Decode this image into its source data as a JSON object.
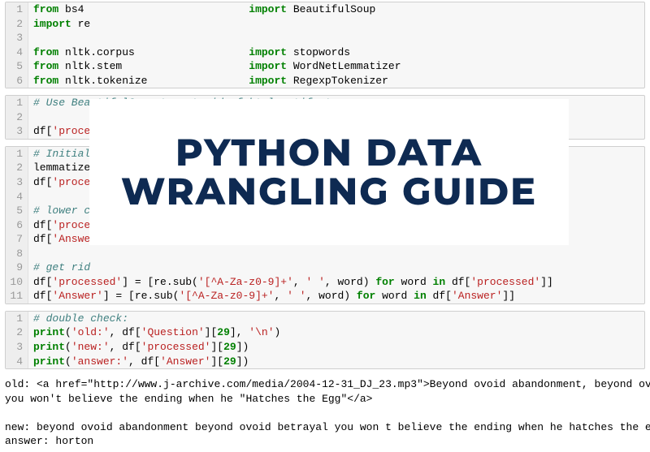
{
  "cells": [
    {
      "lines": [
        {
          "n": "1",
          "seg": [
            {
              "t": "from",
              "c": "kw"
            },
            {
              "t": " bs4                          ",
              "c": "nm"
            },
            {
              "t": "import",
              "c": "kw"
            },
            {
              "t": " BeautifulSoup",
              "c": "nm"
            }
          ]
        },
        {
          "n": "2",
          "seg": [
            {
              "t": "import",
              "c": "kw"
            },
            {
              "t": " re",
              "c": "nm"
            }
          ]
        },
        {
          "n": "3",
          "seg": []
        },
        {
          "n": "4",
          "seg": [
            {
              "t": "from",
              "c": "kw"
            },
            {
              "t": " nltk.corpus                  ",
              "c": "nm"
            },
            {
              "t": "import",
              "c": "kw"
            },
            {
              "t": " stopwords",
              "c": "nm"
            }
          ]
        },
        {
          "n": "5",
          "seg": [
            {
              "t": "from",
              "c": "kw"
            },
            {
              "t": " nltk.stem                    ",
              "c": "nm"
            },
            {
              "t": "import",
              "c": "kw"
            },
            {
              "t": " WordNetLemmatizer",
              "c": "nm"
            }
          ]
        },
        {
          "n": "6",
          "seg": [
            {
              "t": "from",
              "c": "kw"
            },
            {
              "t": " nltk.tokenize                ",
              "c": "nm"
            },
            {
              "t": "import",
              "c": "kw"
            },
            {
              "t": " RegexpTokenizer",
              "c": "nm"
            }
          ]
        }
      ]
    },
    {
      "lines": [
        {
          "n": "1",
          "seg": [
            {
              "t": "# Use BeautifulSoup to get rid of html artifacts.",
              "c": "cm"
            }
          ]
        },
        {
          "n": "2",
          "seg": []
        },
        {
          "n": "3",
          "seg": [
            {
              "t": "df[",
              "c": "nm"
            },
            {
              "t": "'proces",
              "c": "str"
            }
          ]
        }
      ]
    },
    {
      "lines": [
        {
          "n": "1",
          "seg": [
            {
              "t": "# Initiali",
              "c": "cm"
            }
          ]
        },
        {
          "n": "2",
          "seg": [
            {
              "t": "lemmatizer",
              "c": "nm"
            }
          ]
        },
        {
          "n": "3",
          "seg": [
            {
              "t": "df[",
              "c": "nm"
            },
            {
              "t": "'proces",
              "c": "str"
            }
          ]
        },
        {
          "n": "4",
          "seg": []
        },
        {
          "n": "5",
          "seg": [
            {
              "t": "# lower ca",
              "c": "cm"
            }
          ]
        },
        {
          "n": "6",
          "seg": [
            {
              "t": "df[",
              "c": "nm"
            },
            {
              "t": "'proces",
              "c": "str"
            }
          ]
        },
        {
          "n": "7",
          "seg": [
            {
              "t": "df[",
              "c": "nm"
            },
            {
              "t": "'Answer",
              "c": "str"
            }
          ]
        },
        {
          "n": "8",
          "seg": []
        },
        {
          "n": "9",
          "seg": [
            {
              "t": "# get rid",
              "c": "cm"
            }
          ]
        },
        {
          "n": "10",
          "seg": [
            {
              "t": "df[",
              "c": "nm"
            },
            {
              "t": "'processed'",
              "c": "str"
            },
            {
              "t": "] = [re.sub(",
              "c": "nm"
            },
            {
              "t": "'[^A-Za-z0-9]+'",
              "c": "str"
            },
            {
              "t": ", ",
              "c": "nm"
            },
            {
              "t": "' '",
              "c": "str"
            },
            {
              "t": ", word) ",
              "c": "nm"
            },
            {
              "t": "for",
              "c": "kw"
            },
            {
              "t": " word ",
              "c": "nm"
            },
            {
              "t": "in",
              "c": "kw"
            },
            {
              "t": " df[",
              "c": "nm"
            },
            {
              "t": "'processed'",
              "c": "str"
            },
            {
              "t": "]]",
              "c": "nm"
            }
          ]
        },
        {
          "n": "11",
          "seg": [
            {
              "t": "df[",
              "c": "nm"
            },
            {
              "t": "'Answer'",
              "c": "str"
            },
            {
              "t": "] = [re.sub(",
              "c": "nm"
            },
            {
              "t": "'[^A-Za-z0-9]+'",
              "c": "str"
            },
            {
              "t": ", ",
              "c": "nm"
            },
            {
              "t": "' '",
              "c": "str"
            },
            {
              "t": ", word) ",
              "c": "nm"
            },
            {
              "t": "for",
              "c": "kw"
            },
            {
              "t": " word ",
              "c": "nm"
            },
            {
              "t": "in",
              "c": "kw"
            },
            {
              "t": " df[",
              "c": "nm"
            },
            {
              "t": "'Answer'",
              "c": "str"
            },
            {
              "t": "]]",
              "c": "nm"
            }
          ]
        }
      ]
    },
    {
      "lines": [
        {
          "n": "1",
          "seg": [
            {
              "t": "# double check:",
              "c": "cm"
            }
          ]
        },
        {
          "n": "2",
          "seg": [
            {
              "t": "print",
              "c": "kw"
            },
            {
              "t": "(",
              "c": "nm"
            },
            {
              "t": "'old:'",
              "c": "str"
            },
            {
              "t": ", df[",
              "c": "nm"
            },
            {
              "t": "'Question'",
              "c": "str"
            },
            {
              "t": "][",
              "c": "nm"
            },
            {
              "t": "29",
              "c": "kw"
            },
            {
              "t": "], ",
              "c": "nm"
            },
            {
              "t": "'\\n'",
              "c": "str"
            },
            {
              "t": ")",
              "c": "nm"
            }
          ]
        },
        {
          "n": "3",
          "seg": [
            {
              "t": "print",
              "c": "kw"
            },
            {
              "t": "(",
              "c": "nm"
            },
            {
              "t": "'new:'",
              "c": "str"
            },
            {
              "t": ", df[",
              "c": "nm"
            },
            {
              "t": "'processed'",
              "c": "str"
            },
            {
              "t": "][",
              "c": "nm"
            },
            {
              "t": "29",
              "c": "kw"
            },
            {
              "t": "])",
              "c": "nm"
            }
          ]
        },
        {
          "n": "4",
          "seg": [
            {
              "t": "print",
              "c": "kw"
            },
            {
              "t": "(",
              "c": "nm"
            },
            {
              "t": "'answer:'",
              "c": "str"
            },
            {
              "t": ", df[",
              "c": "nm"
            },
            {
              "t": "'Answer'",
              "c": "str"
            },
            {
              "t": "][",
              "c": "nm"
            },
            {
              "t": "29",
              "c": "kw"
            },
            {
              "t": "])",
              "c": "nm"
            }
          ]
        }
      ]
    }
  ],
  "output_lines": [
    "old: <a href=\"http://www.j-archive.com/media/2004-12-31_DJ_23.mp3\">Beyond ovoid abandonment, beyond ovoid betrayal",
    "you won't believe the ending when he \"Hatches the Egg\"</a>",
    "",
    "new: beyond ovoid abandonment beyond ovoid betrayal you won t believe the ending when he hatches the egg",
    "answer: horton"
  ],
  "overlay": {
    "line1": "PYTHON DATA",
    "line2": "WRANGLING GUIDE"
  }
}
